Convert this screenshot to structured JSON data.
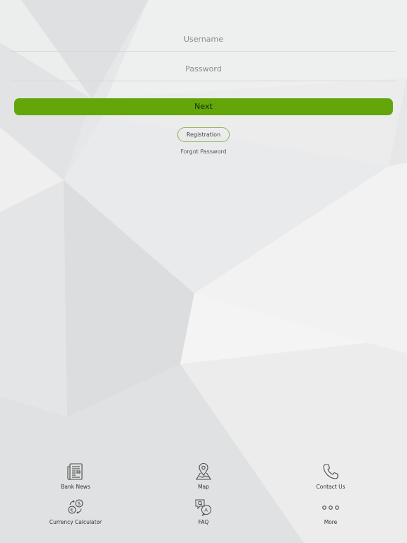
{
  "login": {
    "username_placeholder": "Username",
    "password_placeholder": "Password",
    "next_label": "Next",
    "registration_label": "Registration",
    "forgot_label": "Forgot Password"
  },
  "nav": {
    "items": [
      {
        "label": "Bank News",
        "icon": "newspaper-icon"
      },
      {
        "label": "Map",
        "icon": "map-pin-icon"
      },
      {
        "label": "Contact Us",
        "icon": "phone-icon"
      },
      {
        "label": "Currency Calculator",
        "icon": "currency-exchange-icon"
      },
      {
        "label": "FAQ",
        "icon": "faq-icon"
      },
      {
        "label": "More",
        "icon": "more-dots-icon"
      }
    ]
  },
  "colors": {
    "accent": "#62a60a",
    "registration_border": "#8fb85a",
    "background": "#e8e9ea"
  }
}
